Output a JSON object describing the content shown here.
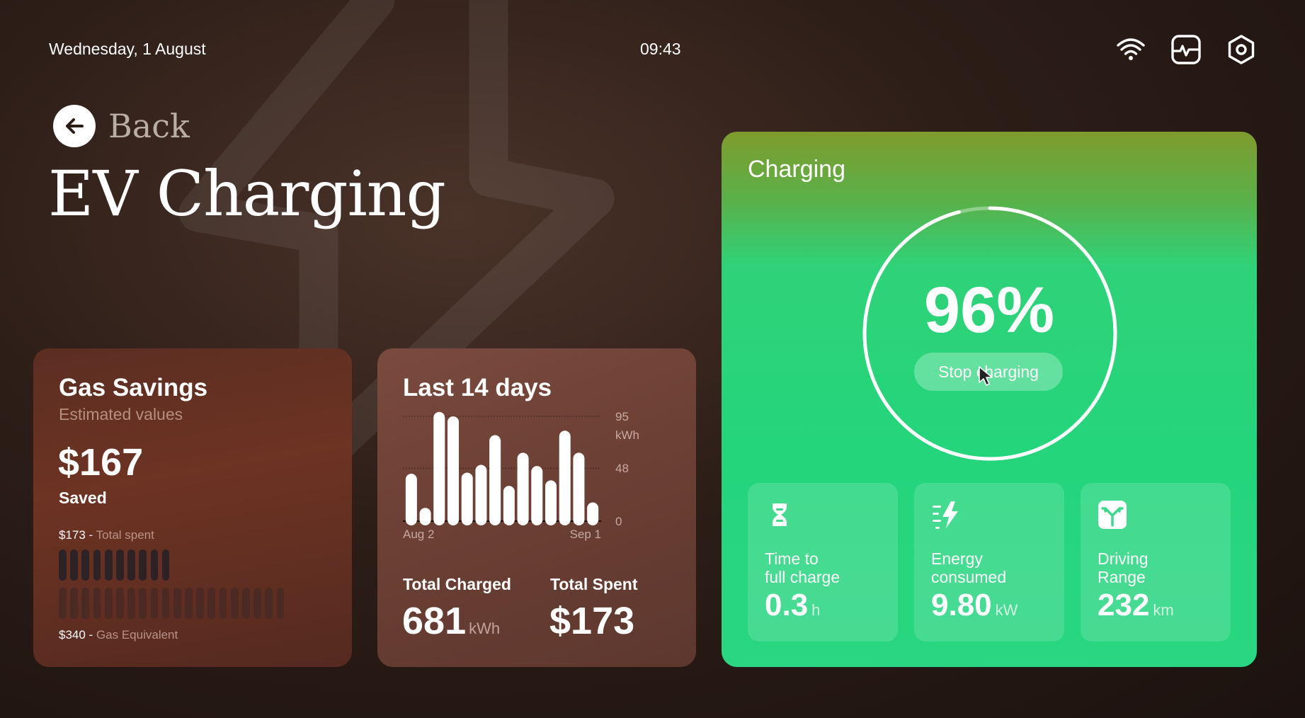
{
  "status_bar": {
    "date": "Wednesday, 1 August",
    "time": "09:43",
    "icons": [
      "wifi-icon",
      "activity-monitor-icon",
      "settings-icon"
    ]
  },
  "nav": {
    "back_label": "Back"
  },
  "page": {
    "title": "EV Charging"
  },
  "gas_savings": {
    "title": "Gas Savings",
    "subtitle": "Estimated values",
    "amount": "$167",
    "amount_label": "Saved",
    "total_spent": {
      "value": "$173",
      "sep": " - ",
      "label": "Total spent"
    },
    "gas_equivalent": {
      "value": "$340",
      "sep": " - ",
      "label": "Gas Equivalent"
    },
    "spent_units": 173,
    "gas_units": 340
  },
  "last_days": {
    "title": "Last 14 days",
    "total_charged_label": "Total Charged",
    "total_charged_value": "681",
    "total_charged_unit": "kWh",
    "total_spent_label": "Total Spent",
    "total_spent_value": "$173"
  },
  "chart_data": {
    "type": "bar",
    "title": "Last 14 days",
    "x_tick_labels": [
      "Aug 2",
      "Sep 1"
    ],
    "y_ticks": [
      "95",
      "48",
      "0"
    ],
    "y_unit": "kWh",
    "ylim": [
      0,
      95
    ],
    "grid": true,
    "values": [
      43,
      12,
      99,
      95,
      44,
      51,
      78,
      32,
      62,
      50,
      37,
      82,
      62,
      17
    ]
  },
  "charging": {
    "title": "Charging",
    "percent": 96,
    "percent_label": "96%",
    "stop_label": "Stop charging",
    "stats": [
      {
        "icon": "hourglass-icon",
        "label": "Time to\nfull charge",
        "value": "0.3",
        "unit": "h"
      },
      {
        "icon": "energy-bolt-icon",
        "label": "Energy\nconsumed",
        "value": "9.80",
        "unit": "kW"
      },
      {
        "icon": "range-road-icon",
        "label": "Driving\nRange",
        "value": "232",
        "unit": "km"
      }
    ]
  },
  "colors": {
    "background": "#2c1d17",
    "charging_green": "#24d57c",
    "gas_card": "#6d3323",
    "days_card": "#6b3f34"
  }
}
